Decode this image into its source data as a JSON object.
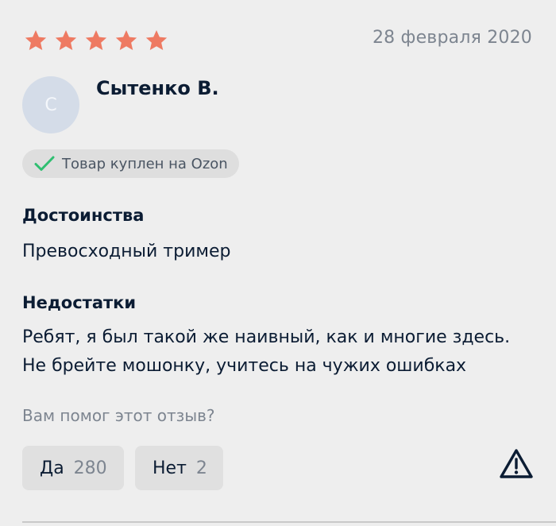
{
  "review": {
    "rating": 5,
    "max_rating": 5,
    "date": "28 февраля 2020",
    "author": {
      "avatar_initial": "С",
      "name": "Сытенко В."
    },
    "badge": {
      "icon": "check-icon",
      "text": "Товар куплен на Ozon"
    },
    "pros": {
      "title": "Достоинства",
      "text": "Превосходный тример"
    },
    "cons": {
      "title": "Недостатки",
      "text": "Ребят, я был такой же наивный, как и многие здесь. Не брейте мошонку, учитесь на чужих ошибках"
    }
  },
  "feedback": {
    "question": "Вам помог этот отзыв?",
    "yes": {
      "label": "Да",
      "count": "280"
    },
    "no": {
      "label": "Нет",
      "count": "2"
    },
    "report_icon": "warning-icon"
  },
  "colors": {
    "star": "#ee7a62",
    "check": "#2fbf71",
    "text": "#0b1c33",
    "muted": "#7d8590",
    "background": "#eeeeee"
  }
}
